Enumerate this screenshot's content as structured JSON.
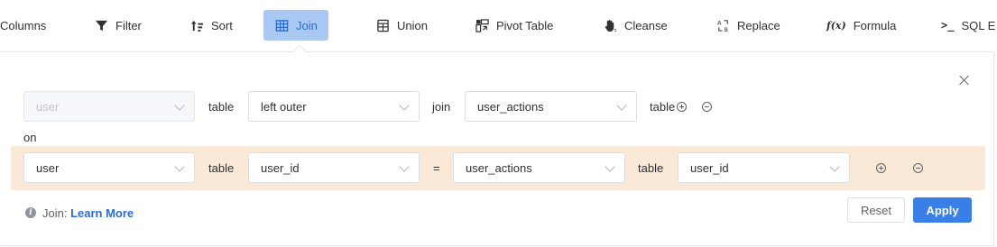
{
  "toolbar": {
    "items": [
      {
        "label": "Columns",
        "icon": "columns-icon"
      },
      {
        "label": "Filter",
        "icon": "filter-icon"
      },
      {
        "label": "Sort",
        "icon": "sort-icon"
      },
      {
        "label": "Join",
        "icon": "join-icon",
        "active": true
      },
      {
        "label": "Union",
        "icon": "union-icon"
      },
      {
        "label": "Pivot Table",
        "icon": "pivot-table-icon"
      },
      {
        "label": "Cleanse",
        "icon": "cleanse-icon"
      },
      {
        "label": "Replace",
        "icon": "replace-icon"
      },
      {
        "label": "Formula",
        "icon": "formula-icon",
        "glyph": "f(x)"
      },
      {
        "label": "SQL E",
        "icon": "sql-icon",
        "glyph": ">_"
      }
    ]
  },
  "join": {
    "left_table": "user",
    "table_word": "table",
    "join_type": "left outer",
    "join_word": "join",
    "right_table": "user_actions",
    "right_table_suffix": "table",
    "on_label": "on"
  },
  "condition": {
    "left_table": "user",
    "table_word": "table",
    "left_column": "user_id",
    "operator": "=",
    "right_table": "user_actions",
    "right_table_word": "table",
    "right_column": "user_id"
  },
  "footer": {
    "hint_prefix": "Join:",
    "learn_more": "Learn More",
    "reset_label": "Reset",
    "apply_label": "Apply"
  },
  "colors": {
    "accent": "#3a7ee8",
    "active_tab_bg": "#a9c9f3",
    "condition_band": "#f9e9d6"
  }
}
